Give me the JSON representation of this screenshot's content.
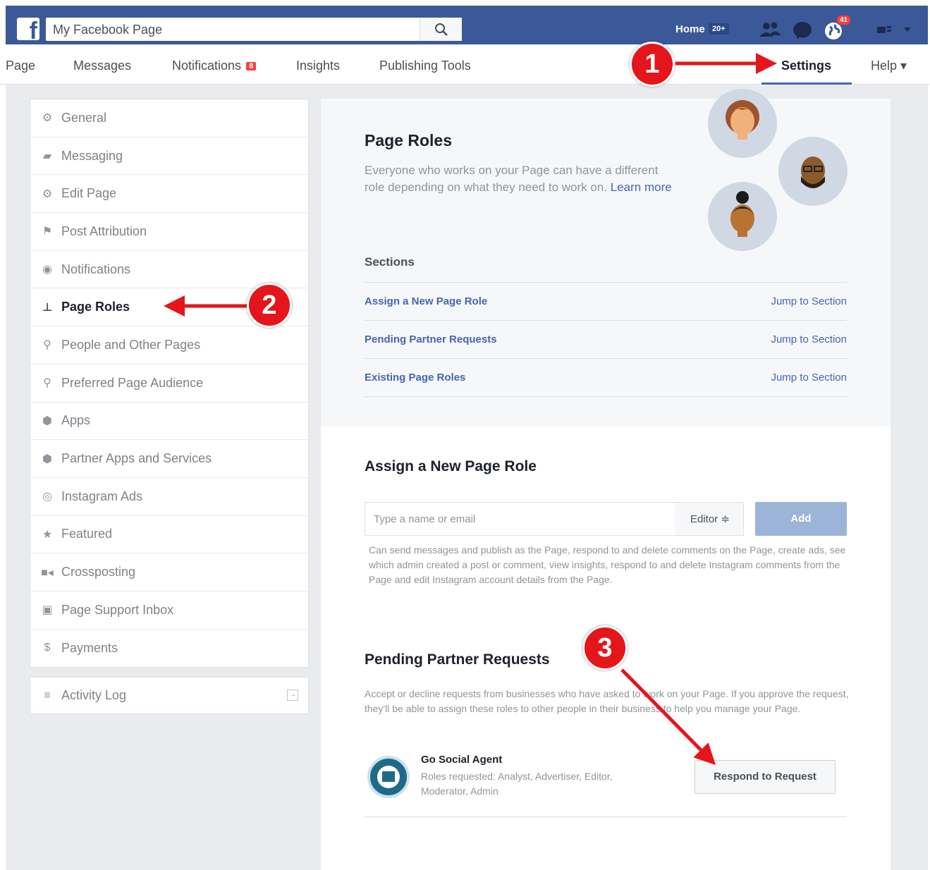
{
  "topbar": {
    "search_value": "My Facebook Page",
    "home_label": "Home",
    "home_badge": "20+",
    "notif_count": "41",
    "icons": [
      "facebook-logo",
      "search-icon",
      "friends-icon",
      "messenger-icon",
      "globe-notifications-icon",
      "account-menu-icon"
    ]
  },
  "pagenav": {
    "tabs": [
      {
        "label": "Page"
      },
      {
        "label": "Messages"
      },
      {
        "label": "Notifications",
        "badge": "8"
      },
      {
        "label": "Insights"
      },
      {
        "label": "Publishing Tools"
      },
      {
        "label": "Settings",
        "active": true
      },
      {
        "label": "Help ▾"
      }
    ]
  },
  "sidebar": {
    "items": [
      {
        "label": "General",
        "icon": "gear-icon"
      },
      {
        "label": "Messaging",
        "icon": "chat-icon"
      },
      {
        "label": "Edit Page",
        "icon": "gear-icon"
      },
      {
        "label": "Post Attribution",
        "icon": "flag-icon"
      },
      {
        "label": "Notifications",
        "icon": "globe-icon"
      },
      {
        "label": "Page Roles",
        "icon": "person-icon",
        "active": true
      },
      {
        "label": "People and Other Pages",
        "icon": "people-icon"
      },
      {
        "label": "Preferred Page Audience",
        "icon": "people-icon"
      },
      {
        "label": "Apps",
        "icon": "cube-icon"
      },
      {
        "label": "Partner Apps and Services",
        "icon": "cube-icon"
      },
      {
        "label": "Instagram Ads",
        "icon": "instagram-icon"
      },
      {
        "label": "Featured",
        "icon": "star-icon"
      },
      {
        "label": "Crossposting",
        "icon": "video-icon"
      },
      {
        "label": "Page Support Inbox",
        "icon": "inbox-icon"
      },
      {
        "label": "Payments",
        "icon": "dollar-icon"
      }
    ],
    "activity_log": "Activity Log"
  },
  "main": {
    "title": "Page Roles",
    "description": "Everyone who works on your Page can have a different role depending on what they need to work on.",
    "learn_more": "Learn more",
    "sections_label": "Sections",
    "sections": [
      {
        "label": "Assign a New Page Role",
        "jump": "Jump to Section"
      },
      {
        "label": "Pending Partner Requests",
        "jump": "Jump to Section"
      },
      {
        "label": "Existing Page Roles",
        "jump": "Jump to Section"
      }
    ],
    "assign": {
      "heading": "Assign a New Page Role",
      "placeholder": "Type a name or email",
      "role": "Editor ≑",
      "add_label": "Add",
      "description": "Can send messages and publish as the Page, respond to and delete comments on the Page, create ads, see which admin created a post or comment, view insights, respond to and delete Instagram comments from the Page and edit Instagram account details from the Page."
    },
    "pending": {
      "heading": "Pending Partner Requests",
      "description": "Accept or decline requests from businesses who have asked to work on your Page. If you approve the request, they'll be able to assign these roles to other people in their business to help you manage your Page.",
      "agent_name": "Go Social Agent",
      "agent_roles": "Roles requested: Analyst, Advertiser, Editor, Moderator, Admin",
      "respond_label": "Respond to Request"
    }
  },
  "annotations": {
    "markers": [
      "1",
      "2",
      "3"
    ],
    "color": "#e4161b"
  }
}
